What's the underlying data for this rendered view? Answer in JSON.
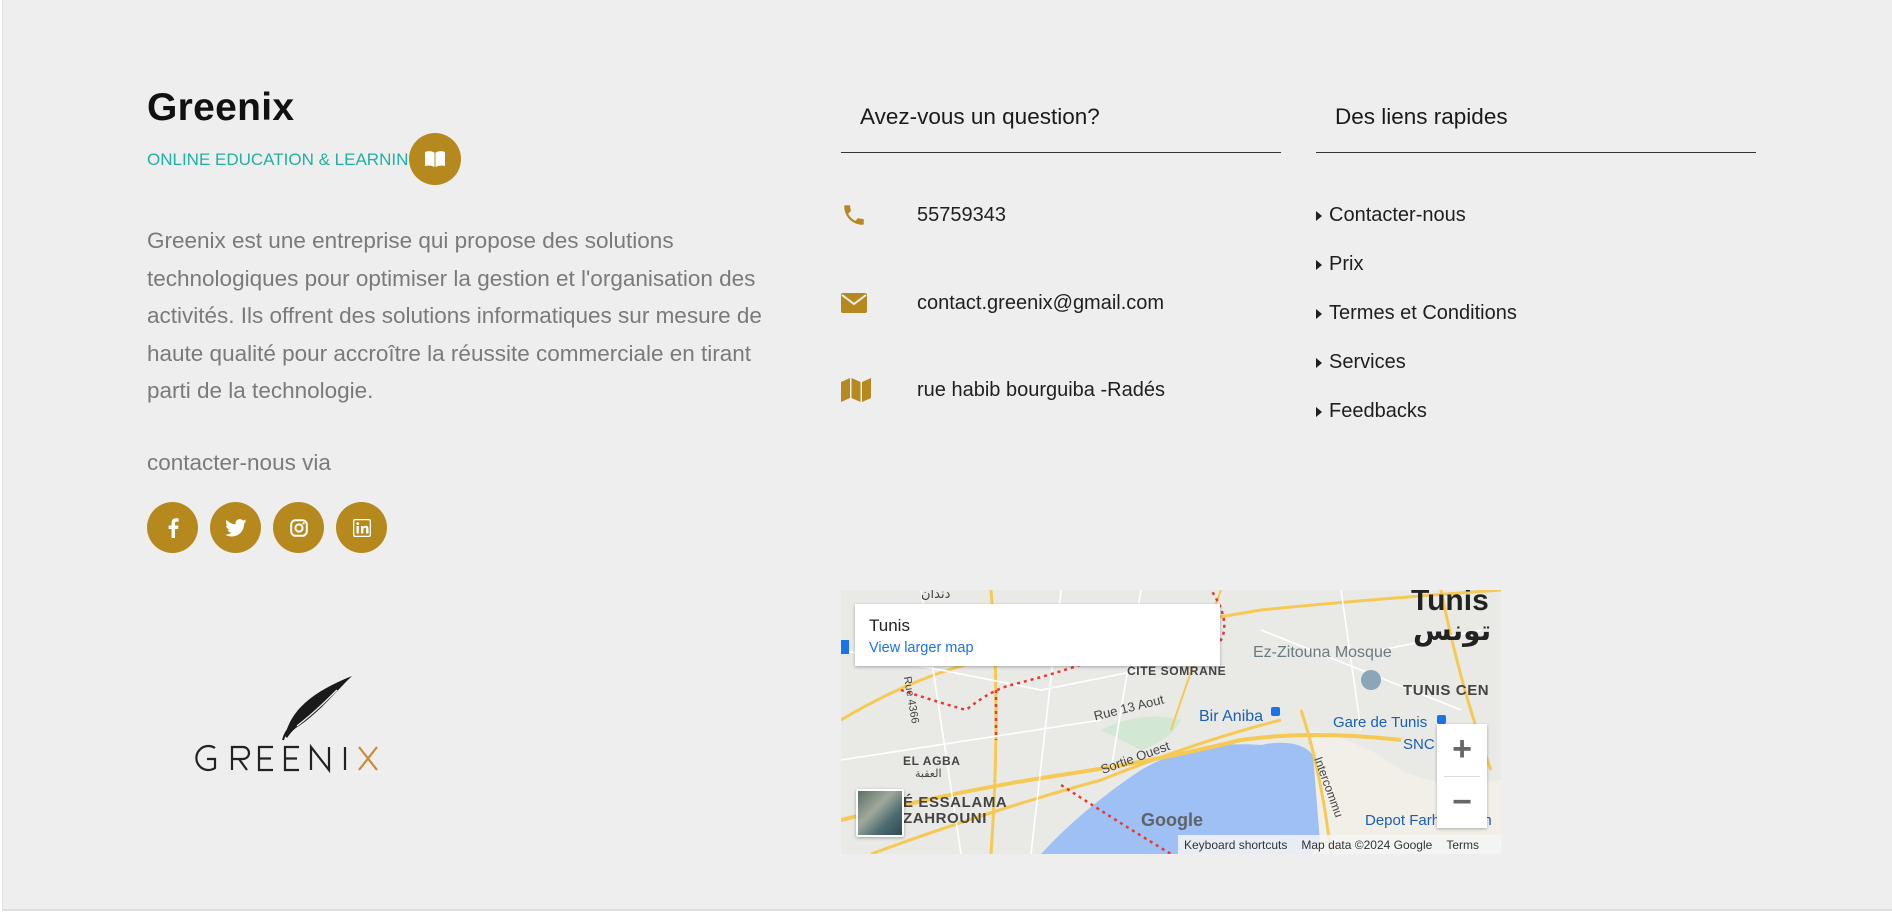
{
  "brand": {
    "title": "Greenix",
    "subtitle": "ONLINE EDUCATION & LEARNING",
    "description": "Greenix est une entreprise qui propose des solutions technologiques pour optimiser la gestion et l'organisation des activités. Ils offrent des solutions informatiques sur mesure de haute qualité pour accroître la réussite commerciale en tirant parti de la technologie.",
    "contact_via": "contacter-nous via",
    "socials": [
      {
        "name": "facebook-icon",
        "glyph": "f"
      },
      {
        "name": "twitter-icon"
      },
      {
        "name": "instagram-icon"
      },
      {
        "name": "linkedin-icon",
        "glyph": "in"
      }
    ],
    "logo_text": "GREENIX"
  },
  "questions": {
    "heading": "Avez-vous un question?",
    "phone": "55759343",
    "email": "contact.greenix@gmail.com",
    "address": "rue habib bourguiba -Radés"
  },
  "quick_links": {
    "heading": "Des liens rapides",
    "items": [
      "Contacter-nous",
      "Prix",
      "Termes et Conditions",
      "Services",
      "Feedbacks"
    ]
  },
  "map": {
    "place": "Tunis",
    "view_larger": "View larger map",
    "labels": {
      "tunis": "Tunis",
      "tunis_ar": "تونس",
      "zitouna": "Ez-Zitouna Mosque",
      "tunis_center": "TUNIS CEN",
      "gare": "Gare de Tunis",
      "snc": "SNC",
      "bir_aniba": "Bir Aniba",
      "rue_13_aout": "Rue 13 Aout",
      "cite_somrane": "CITÉ SOMRANE",
      "el_agba": "EL AGBA",
      "el_agba_ar": "العقبة",
      "essalama": "É ESSALAMA",
      "zahrouni": "ZAHROUNI",
      "sortie_ouest": "Sortie Ouest",
      "intercommunale": "Intercommu",
      "depot": "Depot Farhat Hach",
      "rue_4366": "Rue 4366",
      "top_ar": "دندان"
    },
    "zoom_in": "+",
    "zoom_out": "−",
    "google": "Google",
    "keyboard": "Keyboard shortcuts",
    "map_data": "Map data ©2024 Google",
    "terms": "Terms"
  },
  "colors": {
    "accent": "#b6891f",
    "teal": "#21b1a3"
  }
}
